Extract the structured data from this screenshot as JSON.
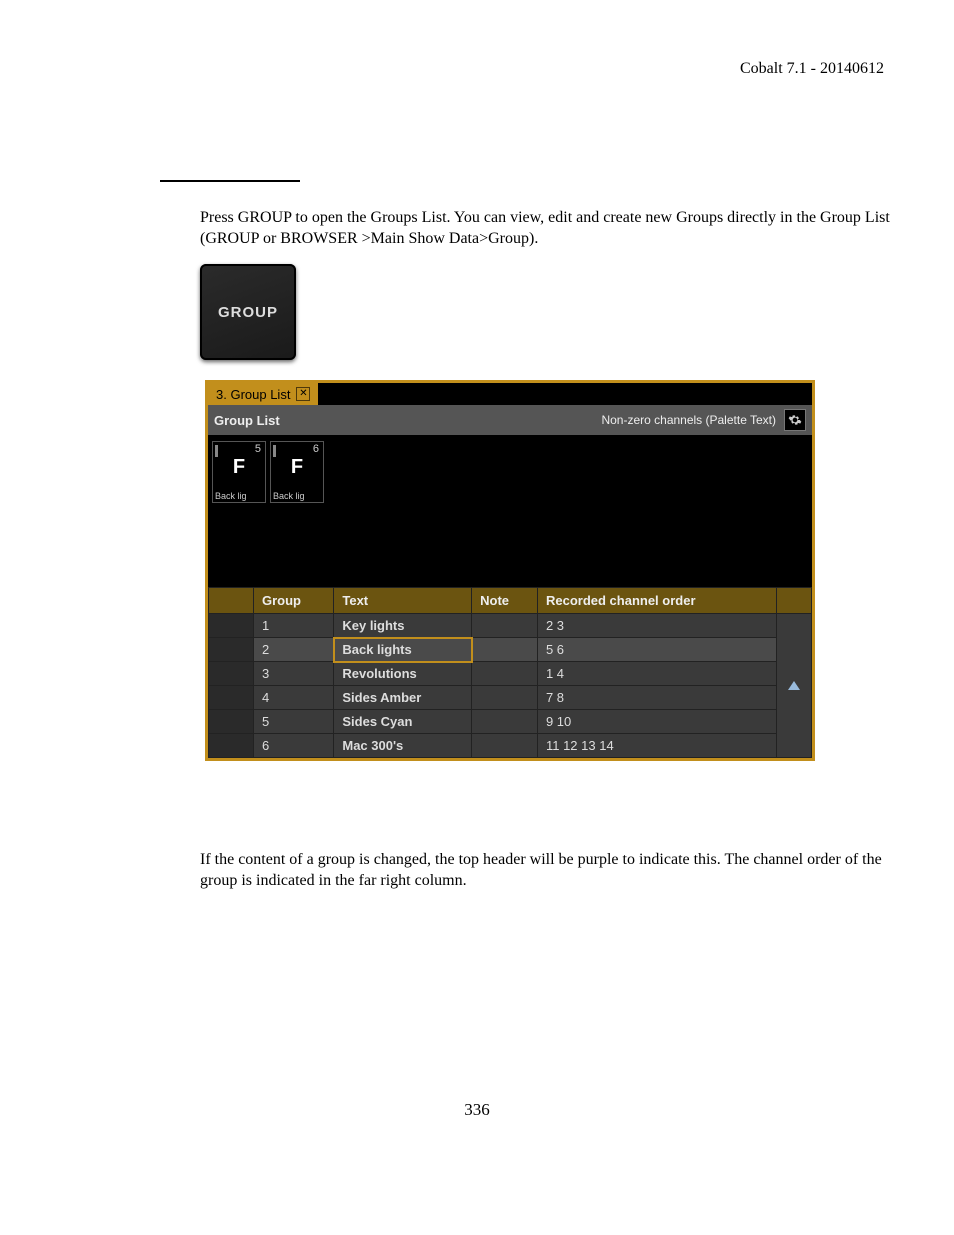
{
  "header": "Cobalt 7.1 - 20140612",
  "paragraph_1": "Press GROUP to open the Groups List. You can view, edit and create new Groups directly in the Group List (GROUP or BROWSER >Main Show Data>Group).",
  "paragraph_2": "If the content of a group is changed, the top header will be purple to indicate this. The channel order of the group is indicated in the far right column.",
  "page_number": "336",
  "key_label": "GROUP",
  "screenshot": {
    "tab_label": "3. Group List",
    "title_left": "Group List",
    "title_right": "Non-zero channels (Palette Text)",
    "channels": [
      {
        "num": "5",
        "val": "F",
        "label": "Back lig"
      },
      {
        "num": "6",
        "val": "F",
        "label": "Back lig"
      }
    ],
    "columns": {
      "c0": "",
      "c1": "Group",
      "c2": "Text",
      "c3": "Note",
      "c4": "Recorded channel order"
    },
    "rows": [
      {
        "group": "1",
        "text": "Key lights",
        "note": "",
        "order": "2 3",
        "selected": false
      },
      {
        "group": "2",
        "text": "Back lights",
        "note": "",
        "order": "5 6",
        "selected": true
      },
      {
        "group": "3",
        "text": "Revolutions",
        "note": "",
        "order": "1 4",
        "selected": false
      },
      {
        "group": "4",
        "text": "Sides Amber",
        "note": "",
        "order": "7 8",
        "selected": false
      },
      {
        "group": "5",
        "text": "Sides Cyan",
        "note": "",
        "order": "9 10",
        "selected": false
      },
      {
        "group": "6",
        "text": "Mac 300's",
        "note": "",
        "order": "11 12 13 14",
        "selected": false
      }
    ]
  }
}
